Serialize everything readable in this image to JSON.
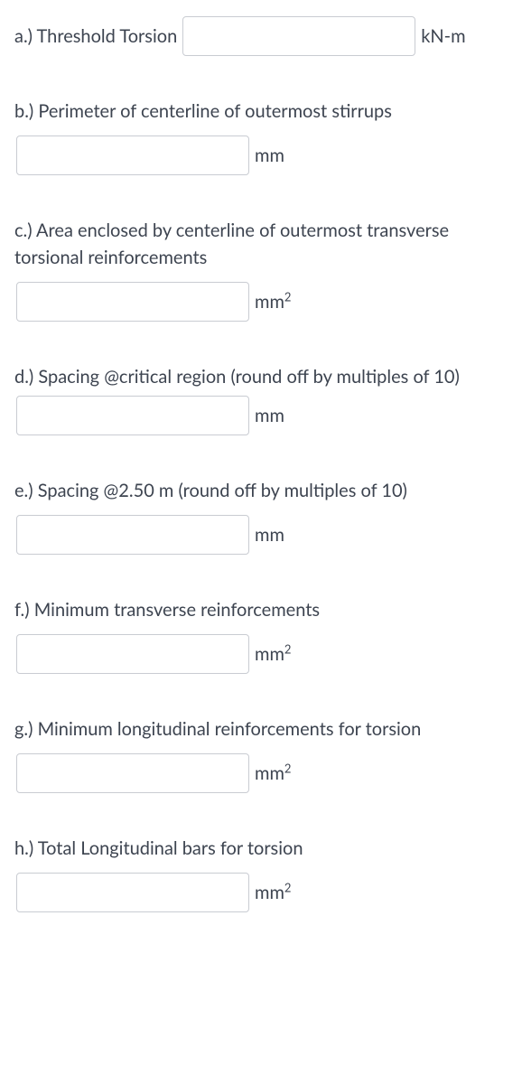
{
  "questions": {
    "a": {
      "label": "a.) Threshold Torsion",
      "unit": "kN-m"
    },
    "b": {
      "label": "b.) Perimeter of centerline of outermost stirrups",
      "unit": "mm"
    },
    "c": {
      "label": "c.) Area enclosed by centerline of outermost transverse torsional reinforcements",
      "unit_base": "mm",
      "unit_sup": "2"
    },
    "d": {
      "label_pre": "d.) Spacing @critical region (round off by multiples of 10)",
      "unit": "mm"
    },
    "e": {
      "label": "e.) Spacing @2.50 m (round off by multiples of 10)",
      "unit": "mm"
    },
    "f": {
      "label": "f.) Minimum transverse reinforcements",
      "unit_base": "mm",
      "unit_sup": "2"
    },
    "g": {
      "label": "g.) Minimum longitudinal reinforcements for torsion",
      "unit_base": "mm",
      "unit_sup": "2"
    },
    "h": {
      "label": "h.) Total Longitudinal bars for torsion",
      "unit_base": "mm",
      "unit_sup": "2"
    }
  }
}
